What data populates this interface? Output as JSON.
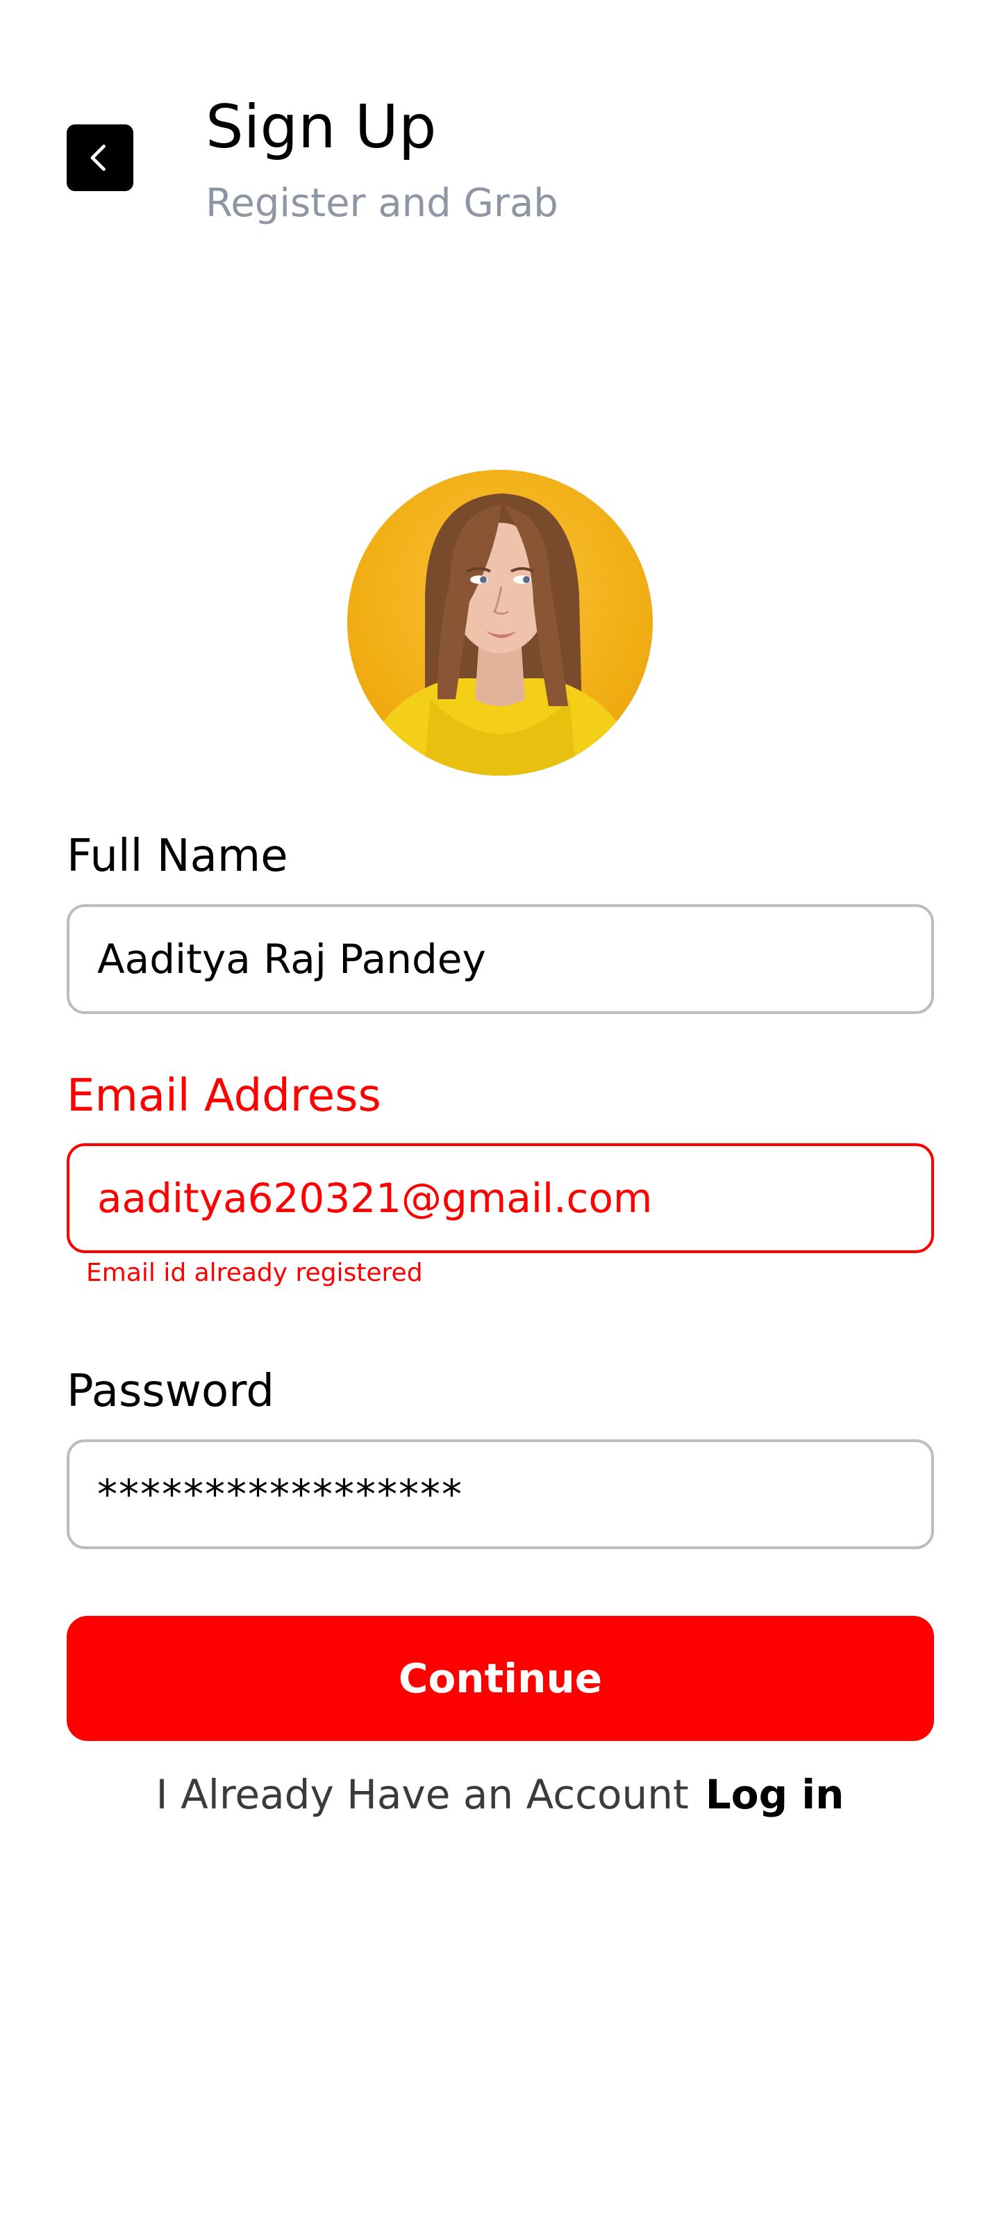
{
  "header": {
    "title": "Sign Up",
    "subtitle": "Register and Grab",
    "back_icon": "chevron-left-icon"
  },
  "avatar": {
    "description_icon": "profile-photo",
    "background_color": "#f4b21c"
  },
  "form": {
    "full_name": {
      "label": "Full Name",
      "value": "Aaditya Raj Pandey"
    },
    "email": {
      "label": "Email Address",
      "value": "aaditya620321@gmail.com",
      "error": "Email id already registered",
      "state": "error"
    },
    "password": {
      "label": "Password",
      "value": "*****************"
    },
    "continue_label": "Continue"
  },
  "footer": {
    "prompt": "I Already Have an Account",
    "login_label": "Log in"
  },
  "colors": {
    "accent": "#ff0000",
    "text_primary": "#000000",
    "text_secondary": "#8e95a3",
    "border": "#bdbdbd"
  }
}
